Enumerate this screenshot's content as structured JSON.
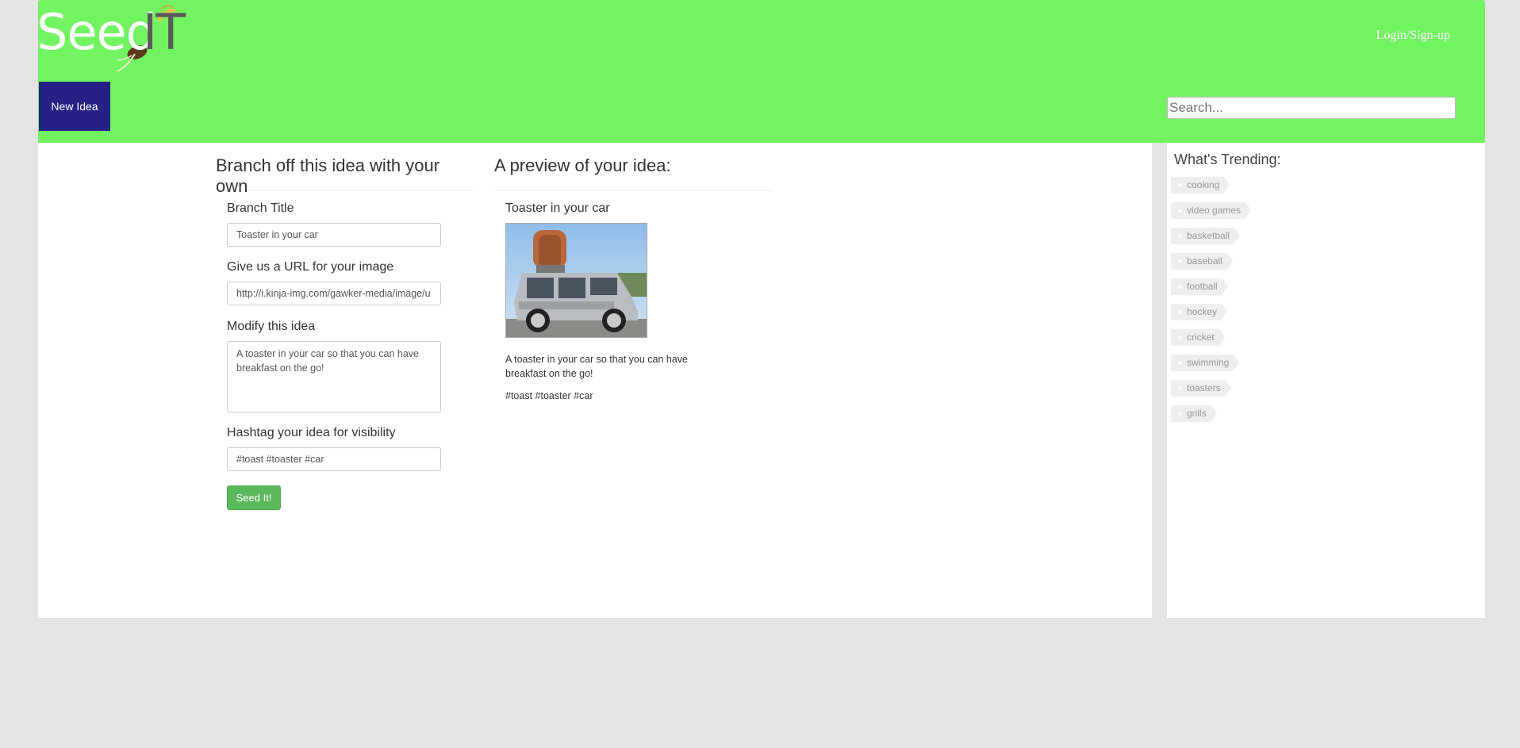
{
  "header": {
    "logo_text_a": "Seed",
    "logo_text_b": "IT",
    "login_label": "Login/Sign-up",
    "new_idea_label": "New Idea",
    "search_placeholder": "Search...",
    "background_color": "#72f362",
    "new_idea_color": "#272185"
  },
  "form": {
    "heading": "Branch off this idea with your own",
    "title_label": "Branch Title",
    "title_value": "Toaster in your car",
    "url_label": "Give us a URL for your image",
    "url_value": "http://i.kinja-img.com/gawker-media/image/u",
    "modify_label": "Modify this idea",
    "modify_value": "A toaster in your car so that you can have breakfast on the go!",
    "hashtag_label": "Hashtag your idea for visibility",
    "hashtag_value": "#toast #toaster #car",
    "submit_label": "Seed It!",
    "submit_color": "#5cb85c"
  },
  "preview": {
    "heading": "A preview of your idea:",
    "title": "Toaster in your car",
    "description": "A toaster in your car so that you can have breakfast on the go!",
    "tags": "#toast #toaster #car"
  },
  "trending": {
    "heading": "What's Trending:",
    "tags": [
      "cooking",
      "video games",
      "basketball",
      "baseball",
      "football",
      "hockey",
      "cricket",
      "swimming",
      "toasters",
      "grills"
    ]
  }
}
